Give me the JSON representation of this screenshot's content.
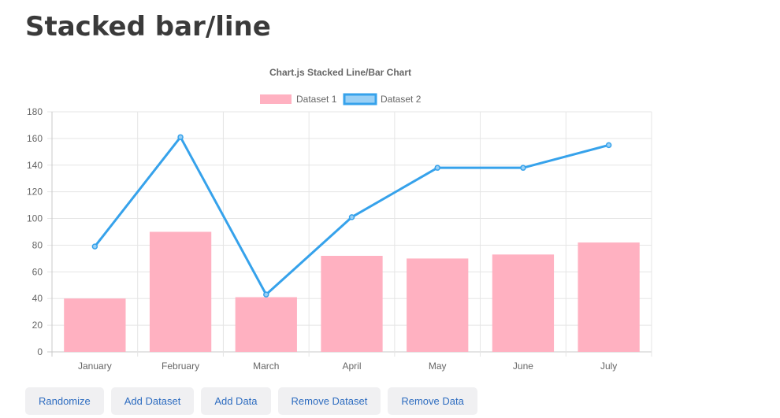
{
  "page": {
    "title": "Stacked bar/line"
  },
  "buttons": [
    {
      "label": "Randomize"
    },
    {
      "label": "Add Dataset"
    },
    {
      "label": "Add Data"
    },
    {
      "label": "Remove Dataset"
    },
    {
      "label": "Remove Data"
    }
  ],
  "chart_data": {
    "type": "bar",
    "title": "Chart.js Stacked Line/Bar Chart",
    "categories": [
      "January",
      "February",
      "March",
      "April",
      "May",
      "June",
      "July"
    ],
    "xlabel": "",
    "ylabel": "",
    "ylim": [
      0,
      180
    ],
    "yticks": [
      0,
      20,
      40,
      60,
      80,
      100,
      120,
      140,
      160,
      180
    ],
    "grid": true,
    "stacked": true,
    "legend_position": "top",
    "series": [
      {
        "name": "Dataset 1",
        "type": "bar",
        "values": [
          40,
          90,
          41,
          72,
          70,
          73,
          82
        ],
        "fill": "#ffb1c1",
        "stroke": "#ff6384"
      },
      {
        "name": "Dataset 2",
        "type": "line",
        "values": [
          79,
          161,
          43,
          101,
          138,
          138,
          155
        ],
        "fill": "#9ad0f5",
        "stroke": "#36a2eb"
      }
    ]
  }
}
